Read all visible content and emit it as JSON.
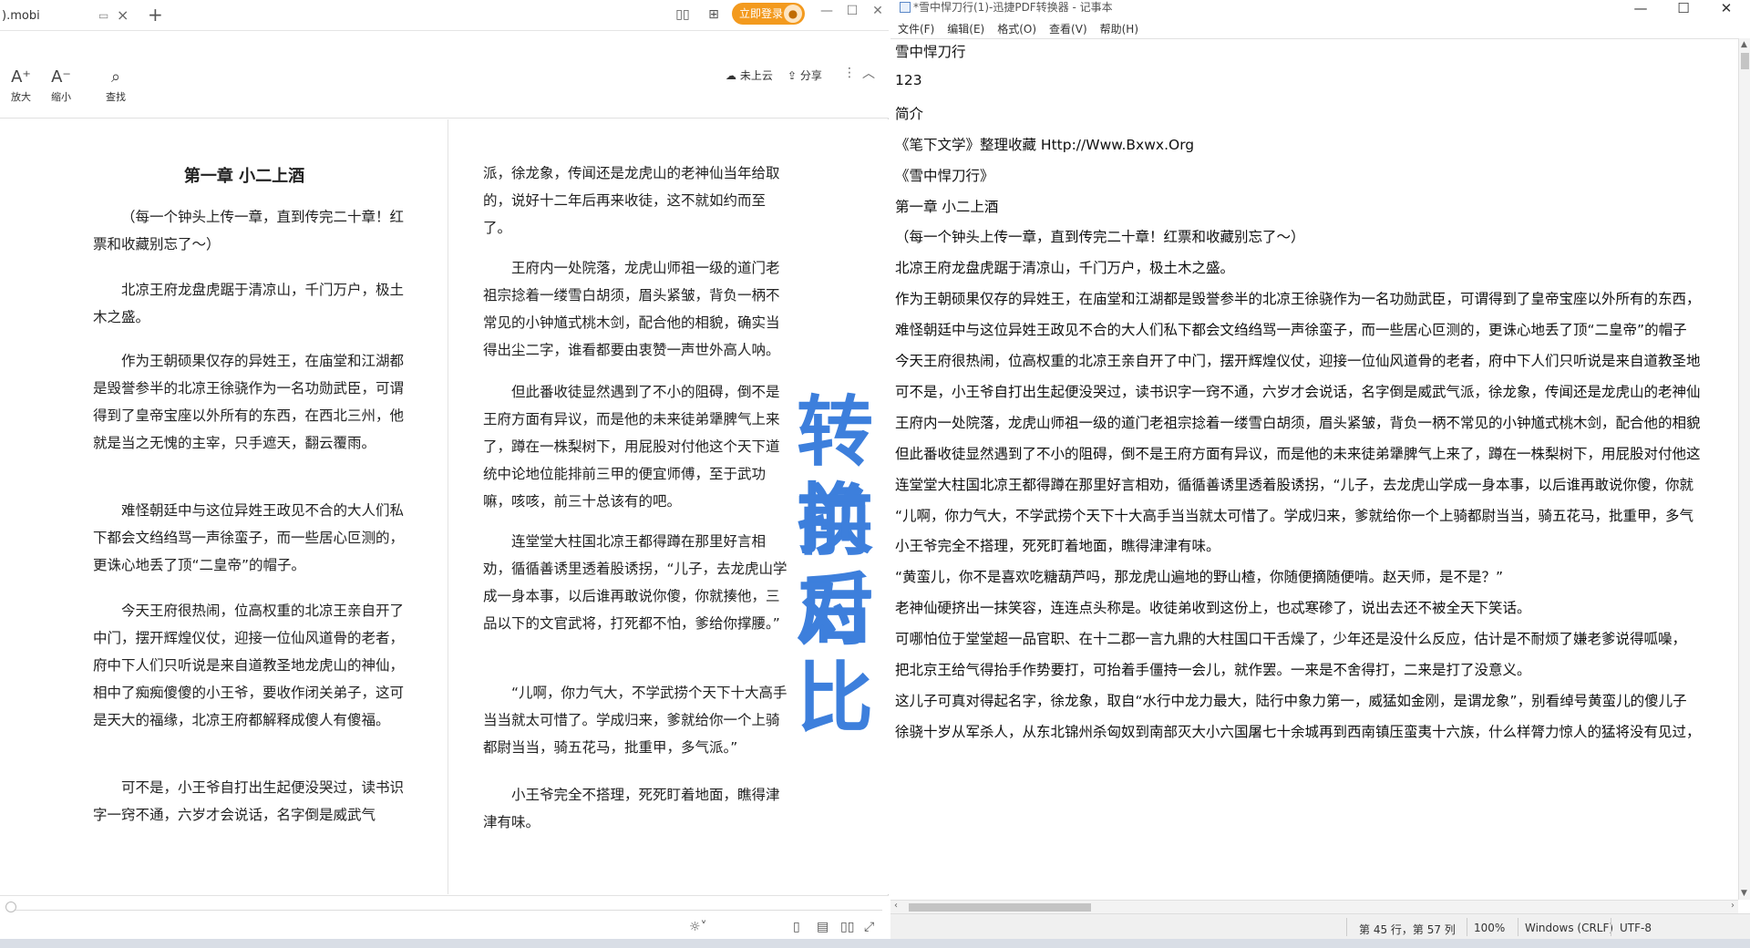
{
  "reader": {
    "tab_title": ").mobi",
    "new_tab_icon": "plus-icon",
    "login_label": "立即登录",
    "toolbar": {
      "zoom_in": "放大",
      "zoom_out": "缩小",
      "find": "查找",
      "cloud_label": "未上云",
      "share_label": "分享"
    },
    "chapter_title": "第一章 小二上酒",
    "left_paragraphs": [
      "（每一个钟头上传一章，直到传完二十章！红票和收藏别忘了～）",
      "北凉王府龙盘虎踞于清凉山，千门万户，极土木之盛。",
      "作为王朝硕果仅存的异姓王，在庙堂和江湖都是毁誉参半的北凉王徐骁作为一名功勋武臣，可谓得到了皇帝宝座以外所有的东西，在西北三州，他就是当之无愧的主宰，只手遮天，翻云覆雨。",
      "难怪朝廷中与这位异姓王政见不合的大人们私下都会文绉绉骂一声徐蛮子，而一些居心叵测的，更诛心地丢了顶“二皇帝”的帽子。",
      "今天王府很热闹，位高权重的北凉王亲自开了中门，摆开辉煌仪仗，迎接一位仙风道骨的老者，府中下人们只听说是来自道教圣地龙虎山的神仙，相中了痴痴傻傻的小王爷，要收作闭关弟子，这可是天大的福缘，北凉王府都解释成傻人有傻福。",
      "可不是，小王爷自打出生起便没哭过，读书识字一窍不通，六岁才会说话，名字倒是威武气"
    ],
    "right_paragraphs": [
      "派，徐龙象，传闻还是龙虎山的老神仙当年给取的，说好十二年后再来收徒，这不就如约而至了。",
      "王府内一处院落，龙虎山师祖一级的道门老祖宗捻着一缕雪白胡须，眉头紧皱，背负一柄不常见的小钟馗式桃木剑，配合他的相貌，确实当得出尘二字，谁看都要由衷赞一声世外高人呐。",
      "但此番收徒显然遇到了不小的阻碍，倒不是王府方面有异议，而是他的未来徒弟犟脾气上来了，蹲在一株梨树下，用屁股对付他这个天下道统中论地位能排前三甲的便宜师傅，至于武功嘛，咳咳，前三十总该有的吧。",
      "连堂堂大柱国北凉王都得蹲在那里好言相劝，循循善诱里透着股诱拐，“儿子，去龙虎山学成一身本事，以后谁再敢说你傻，你就揍他，三品以下的文官武将，打死都不怕，爹给你撑腰。”",
      "“儿啊，你力气大，不学武捞个天下十大高手当当就太可惜了。学成归来，爹就给你一个上骑都尉当当，骑五花马，批重甲，多气派。”",
      "小王爷完全不搭理，死死盯着地面，瞧得津津有味。"
    ]
  },
  "overlay_text": [
    "转换",
    "前后",
    "对比"
  ],
  "notepad": {
    "title": "*雪中悍刀行(1)-迅捷PDF转换器 - 记事本",
    "menu": [
      "文件(F)",
      "编辑(E)",
      "格式(O)",
      "查看(V)",
      "帮助(H)"
    ],
    "lines": [
      "雪中悍刀行",
      "123",
      "简介",
      "《笔下文学》整理收藏 Http://Www.Bxwx.Org",
      "《雪中悍刀行》",
      "第一章 小二上酒",
      "（每一个钟头上传一章，直到传完二十章！红票和收藏别忘了～）",
      "北凉王府龙盘虎踞于清凉山，千门万户，极土木之盛。",
      "作为王朝硕果仅存的异姓王，在庙堂和江湖都是毁誉参半的北凉王徐骁作为一名功勋武臣，可谓得到了皇帝宝座以外所有的东西，",
      "难怪朝廷中与这位异姓王政见不合的大人们私下都会文绉绉骂一声徐蛮子，而一些居心叵测的，更诛心地丢了顶“二皇帝”的帽子",
      "今天王府很热闹，位高权重的北凉王亲自开了中门，摆开辉煌仪仗，迎接一位仙风道骨的老者，府中下人们只听说是来自道教圣地",
      "可不是，小王爷自打出生起便没哭过，读书识字一窍不通，六岁才会说话，名字倒是威武气派，徐龙象，传闻还是龙虎山的老神仙",
      "王府内一处院落，龙虎山师祖一级的道门老祖宗捻着一缕雪白胡须，眉头紧皱，背负一柄不常见的小钟馗式桃木剑，配合他的相貌",
      "但此番收徒显然遇到了不小的阻碍，倒不是王府方面有异议，而是他的未来徒弟犟脾气上来了，蹲在一株梨树下，用屁股对付他这",
      "连堂堂大柱国北凉王都得蹲在那里好言相劝，循循善诱里透着股诱拐，“儿子，去龙虎山学成一身本事，以后谁再敢说你傻，你就",
      "“儿啊，你力气大，不学武捞个天下十大高手当当就太可惜了。学成归来，爹就给你一个上骑都尉当当，骑五花马，批重甲，多气",
      "小王爷完全不搭理，死死盯着地面，瞧得津津有味。",
      "“黄蛮儿，你不是喜欢吃糖葫芦吗，那龙虎山遍地的野山楂，你随便摘随便啃。赵天师，是不是？”",
      "老神仙硬挤出一抹笑容，连连点头称是。收徒弟收到这份上，也忒寒碜了，说出去还不被全天下笑话。",
      "可哪怕位于堂堂超一品官职、在十二郡一言九鼎的大柱国口干舌燥了，少年还是没什么反应，估计是不耐烦了嫌老爹说得呱噪，",
      "把北京王给气得抬手作势要打，可抬着手僵持一会儿，就作罢。一来是不舍得打，二来是打了没意义。",
      "这儿子可真对得起名字，徐龙象，取自“水行中龙力最大，陆行中象力第一，威猛如金刚，是谓龙象”，别看绰号黄蛮儿的傻儿子",
      "徐骁十岁从军杀人，从东北锦州杀匈奴到南部灭大小六国屠七十余城再到西南镇压蛮夷十六族，什么样膂力惊人的猛将没有见过，"
    ],
    "status": {
      "position": "第 45 行，第 57 列",
      "zoom": "100%",
      "line_ending": "Windows (CRLF)",
      "encoding": "UTF-8"
    }
  }
}
